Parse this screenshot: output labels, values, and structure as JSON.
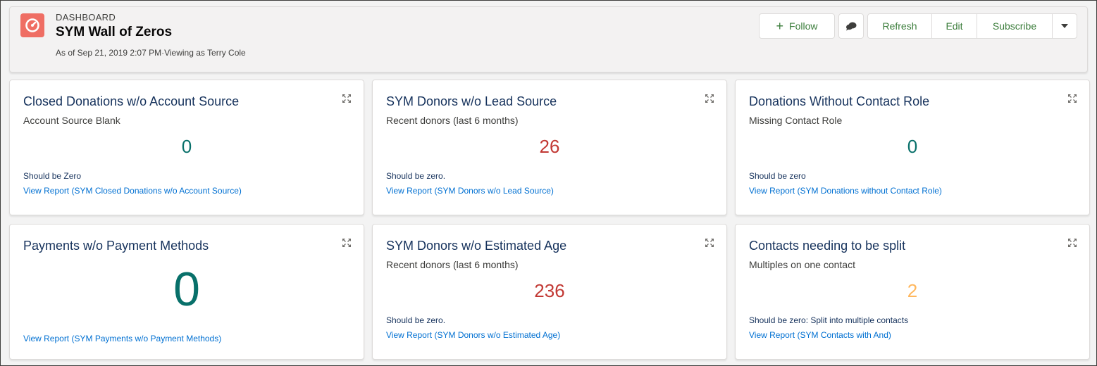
{
  "header": {
    "eyebrow": "DASHBOARD",
    "title": "SYM Wall of Zeros",
    "meta": "As of Sep 21, 2019 2:07 PM·Viewing as Terry Cole",
    "buttons": {
      "follow": "Follow",
      "refresh": "Refresh",
      "edit": "Edit",
      "subscribe": "Subscribe"
    }
  },
  "colors": {
    "teal": "#08706a",
    "red": "#c23934",
    "orange": "#ffb75d",
    "link": "#0070d2",
    "brand_icon": "#ef6e64"
  },
  "cards": [
    {
      "title": "Closed Donations w/o Account Source",
      "subtitle": "Account Source Blank",
      "value": "0",
      "footer": "Should be Zero",
      "link": "View Report (SYM Closed Donations w/o Account Source)"
    },
    {
      "title": "SYM Donors w/o Lead Source",
      "subtitle": "Recent donors (last 6 months)",
      "value": "26",
      "footer": "Should be zero.",
      "link": "View Report (SYM Donors w/o Lead Source)"
    },
    {
      "title": "Donations Without Contact Role",
      "subtitle": "Missing Contact Role",
      "value": "0",
      "footer": "Should be zero",
      "link": "View Report (SYM Donations without Contact Role)"
    },
    {
      "title": "Payments w/o Payment Methods",
      "subtitle": "",
      "value": "0",
      "footer": "",
      "link": "View Report (SYM Payments w/o Payment Methods)"
    },
    {
      "title": "SYM Donors w/o Estimated Age",
      "subtitle": "Recent donors (last 6 months)",
      "value": "236",
      "footer": "Should be zero.",
      "link": "View Report (SYM Donors w/o Estimated Age)"
    },
    {
      "title": "Contacts needing to be split",
      "subtitle": "Multiples on one contact",
      "value": "2",
      "footer": "Should be zero: Split into multiple contacts",
      "link": "View Report (SYM Contacts with And)"
    }
  ],
  "icons": {
    "dashboard": "dashboard-gauge-icon",
    "follow": "plus-icon",
    "chat": "chat-bubbles-icon",
    "more": "chevron-down-icon",
    "expand": "expand-icon"
  }
}
